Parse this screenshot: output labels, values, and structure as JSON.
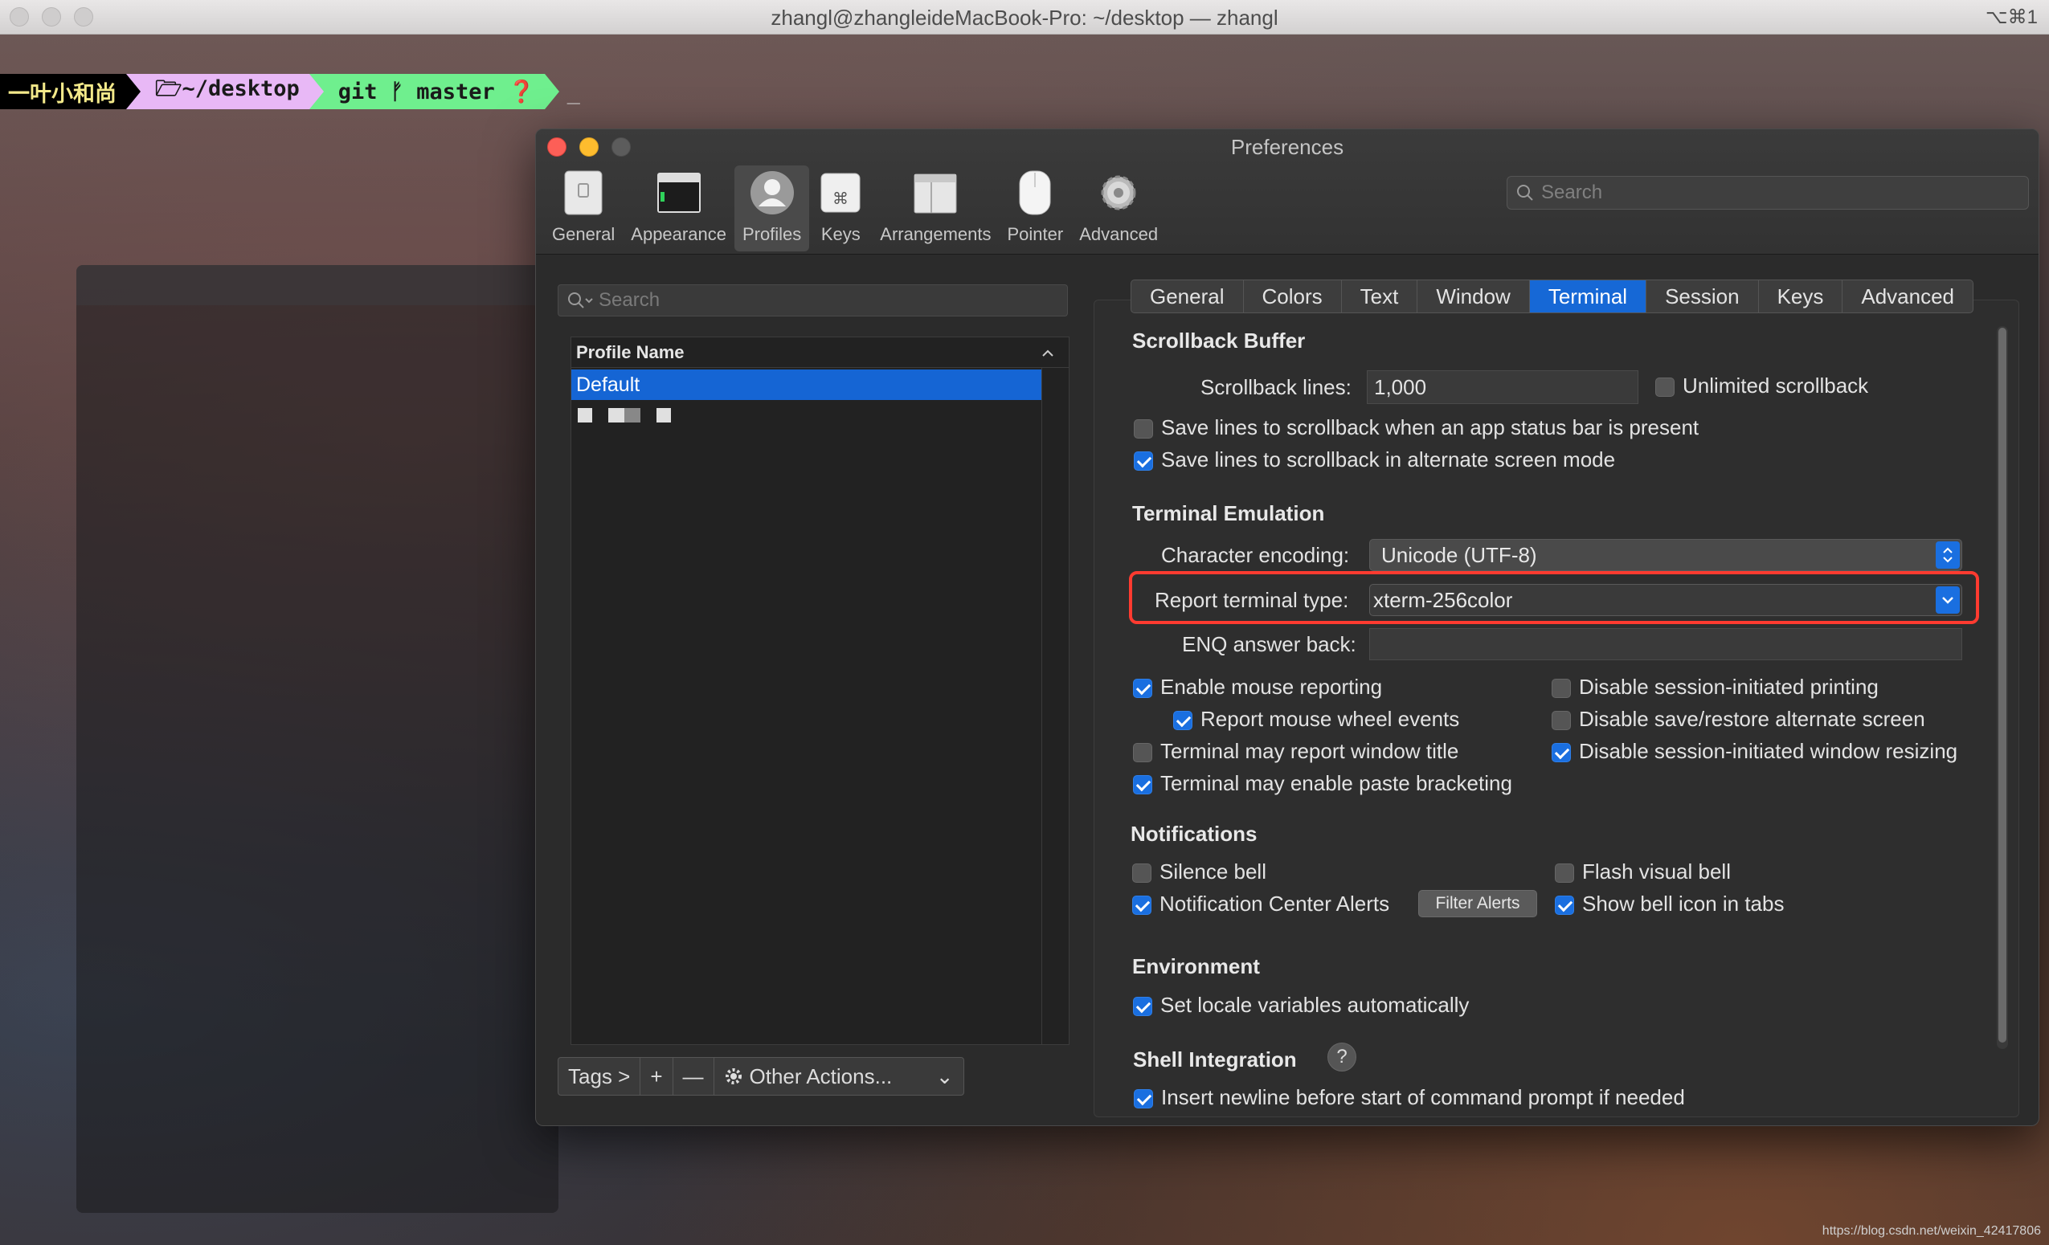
{
  "terminal": {
    "title": "zhangl@zhangleideMacBook-Pro: ~/desktop — zhangl",
    "shortcut": "⌥⌘1",
    "prompt": {
      "user": "一叶小和尚",
      "path": "🗁~/desktop",
      "git": "git ᚠ master ❓",
      "cursor": "_"
    }
  },
  "prefs": {
    "title": "Preferences",
    "toolbar": [
      {
        "label": "General",
        "icon": "general-icon"
      },
      {
        "label": "Appearance",
        "icon": "appearance-icon"
      },
      {
        "label": "Profiles",
        "icon": "profiles-icon",
        "selected": true
      },
      {
        "label": "Keys",
        "icon": "keys-icon"
      },
      {
        "label": "Arrangements",
        "icon": "arrangements-icon"
      },
      {
        "label": "Pointer",
        "icon": "pointer-icon"
      },
      {
        "label": "Advanced",
        "icon": "advanced-gear-icon"
      }
    ],
    "search_placeholder": "Search",
    "profiles": {
      "search_placeholder": "Search",
      "column_header": "Profile Name",
      "rows": [
        "Default"
      ],
      "buttons": {
        "tags": "Tags >",
        "add": "+",
        "remove": "—",
        "other": "Other Actions...",
        "other_chevron": "⌄"
      }
    },
    "tabs": [
      "General",
      "Colors",
      "Text",
      "Window",
      "Terminal",
      "Session",
      "Keys",
      "Advanced"
    ],
    "selected_tab": "Terminal",
    "terminal": {
      "scrollback": {
        "heading": "Scrollback Buffer",
        "lines_label": "Scrollback lines:",
        "lines_value": "1,000",
        "unlimited": "Unlimited scrollback",
        "status_bar": "Save lines to scrollback when an app status bar is present",
        "alternate": "Save lines to scrollback in alternate screen mode"
      },
      "emulation": {
        "heading": "Terminal Emulation",
        "encoding_label": "Character encoding:",
        "encoding_value": "Unicode (UTF-8)",
        "type_label": "Report terminal type:",
        "type_value": "xterm-256color",
        "enq_label": "ENQ answer back:",
        "enq_value": "",
        "mouse_reporting": "Enable mouse reporting",
        "mouse_wheel": "Report mouse wheel events",
        "window_title": "Terminal may report window title",
        "paste_bracketing": "Terminal may enable paste bracketing",
        "disable_printing": "Disable session-initiated printing",
        "disable_save_restore": "Disable save/restore alternate screen",
        "disable_resizing": "Disable session-initiated window resizing"
      },
      "notifications": {
        "heading": "Notifications",
        "silence_bell": "Silence bell",
        "nc_alerts": "Notification Center Alerts",
        "filter_alerts": "Filter Alerts",
        "flash_bell": "Flash visual bell",
        "bell_icon": "Show bell icon in tabs"
      },
      "environment": {
        "heading": "Environment",
        "set_locale": "Set locale variables automatically"
      },
      "shell_integration": {
        "heading": "Shell Integration",
        "help": "?",
        "newline": "Insert newline before start of command prompt if needed"
      }
    }
  },
  "watermark": "https://blog.csdn.net/weixin_42417806",
  "colors": {
    "accent": "#1a6fe0",
    "highlight_box": "#ff3b30"
  }
}
